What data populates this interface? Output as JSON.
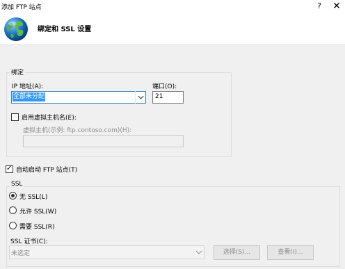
{
  "window": {
    "title": "添加 FTP 站点",
    "help_label": "?",
    "close_label": "✕"
  },
  "header": {
    "title": "绑定和 SSL 设置",
    "icon": "globe-icon"
  },
  "binding": {
    "legend": "绑定",
    "ip_label": "IP 地址(A):",
    "ip_value": "全部未分配",
    "port_label": "端口(O):",
    "port_value": "21",
    "virtual_host_checkbox_label": "启用虚拟主机名(E):",
    "virtual_host_checked": false,
    "virtual_host_label": "虚拟主机(示例: ftp.contoso.com)(H):",
    "virtual_host_value": ""
  },
  "auto_start": {
    "label": "自动启动 FTP 站点(T)",
    "checked": true
  },
  "ssl": {
    "legend": "SSL",
    "options": [
      {
        "label": "无 SSL(L)",
        "selected": true
      },
      {
        "label": "允许 SSL(W)",
        "selected": false
      },
      {
        "label": "需要 SSL(R)",
        "selected": false
      }
    ],
    "cert_label": "SSL 证书(C):",
    "cert_value": "未选定",
    "select_button": "选择(S)...",
    "view_button": "查看(I)..."
  },
  "colors": {
    "selection": "#3399ff",
    "focus_border": "#3c7fb1",
    "disabled_text": "#8a8a8a"
  }
}
